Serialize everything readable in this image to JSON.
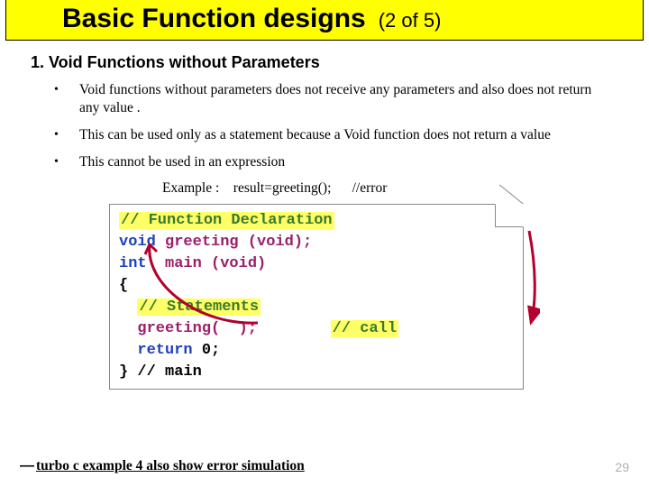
{
  "title": {
    "main": "Basic Function designs",
    "count": "(2 of 5)"
  },
  "heading": "1. Void Functions without Parameters",
  "bullets": [
    "Void functions without parameters  does not receive any parameters and also does not return any value .",
    "This  can be used only as a statement because a Void function does not  return a value",
    "This cannot be used in an expression"
  ],
  "example": {
    "label": "Example :",
    "code": "result=greeting();",
    "note": "//error"
  },
  "code": {
    "c1": "// Function Declaration",
    "l2a": "void",
    "l2b": "greeting (void);",
    "l3a": "int",
    "l3b": "main (void)",
    "l4": "{",
    "c2": "// Statements",
    "l6a": "greeting(",
    "l6b": ");",
    "l6c": "// call",
    "l7a": "return",
    "l7b": "0;",
    "l8": "} // main"
  },
  "footnote": "turbo c example 4 also show error simulation",
  "page": "29"
}
